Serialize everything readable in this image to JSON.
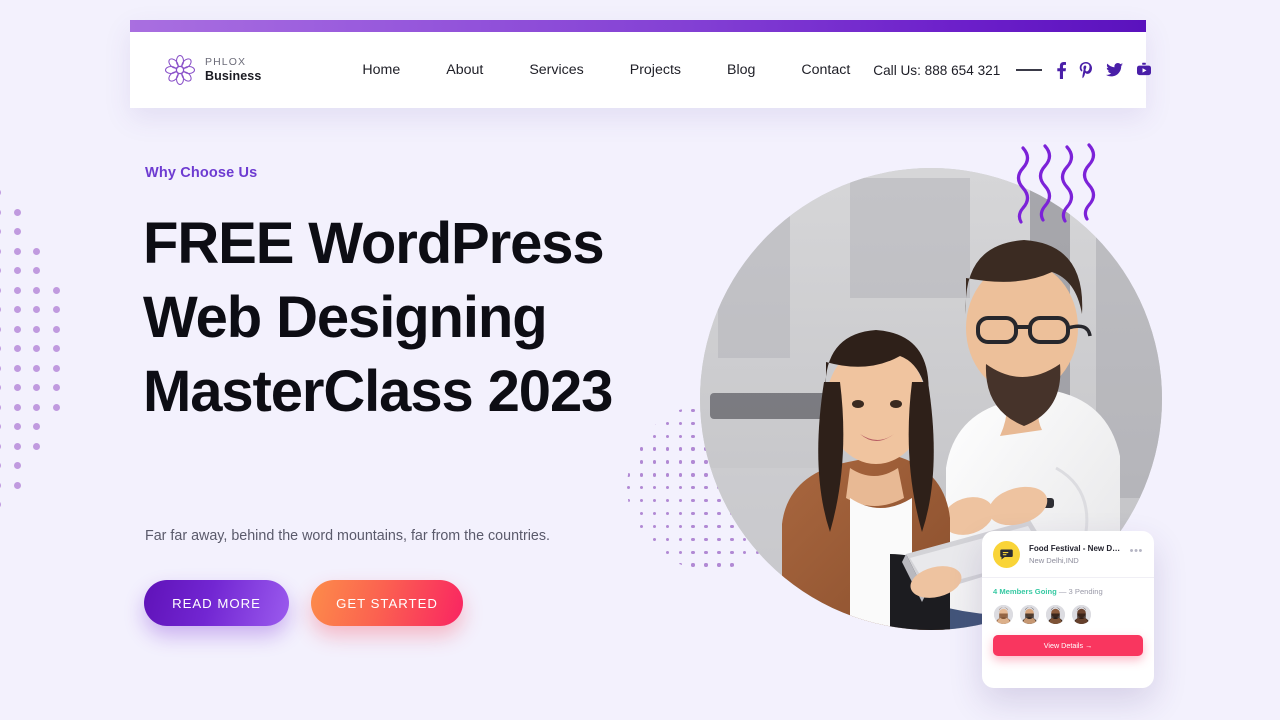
{
  "theme": {
    "page_bg": "#f3f1fd",
    "accent_purple": "#6d3bd1",
    "accent_pink": "#f9365f",
    "accent_yellow": "#f9d438",
    "accent_teal": "#37c9a3",
    "heading_color": "#0d0d14"
  },
  "header": {
    "brand": {
      "top": "PHLOX",
      "bottom": "Business",
      "logo_icon": "lotus-flower-logo"
    },
    "nav": [
      {
        "label": "Home"
      },
      {
        "label": "About"
      },
      {
        "label": "Services"
      },
      {
        "label": "Projects"
      },
      {
        "label": "Blog"
      },
      {
        "label": "Contact"
      }
    ],
    "call_us": "Call Us: 888 654 321",
    "socials": [
      {
        "name": "facebook-icon",
        "label": "Facebook"
      },
      {
        "name": "pinterest-icon",
        "label": "Pinterest"
      },
      {
        "name": "twitter-icon",
        "label": "Twitter"
      },
      {
        "name": "youtube-icon",
        "label": "YouTube"
      }
    ]
  },
  "hero": {
    "eyebrow": "Why Choose Us",
    "headline": "FREE WordPress Web Designing MasterClass 2023",
    "subtext": "Far far away, behind the word mountains, far from the countries.",
    "buttons": {
      "primary": "READ MORE",
      "secondary": "GET STARTED"
    },
    "photo_alt": "two-colleagues-looking-at-tablet"
  },
  "event_card": {
    "icon": "chat-bubble-icon",
    "title": "Food Festival - New Delhi",
    "location": "New Delhi,IND",
    "more_menu": "•••",
    "members_going": "4 Members Going",
    "pending": "— 3 Pending",
    "avatar_count": 4,
    "cta": "View Details →"
  }
}
